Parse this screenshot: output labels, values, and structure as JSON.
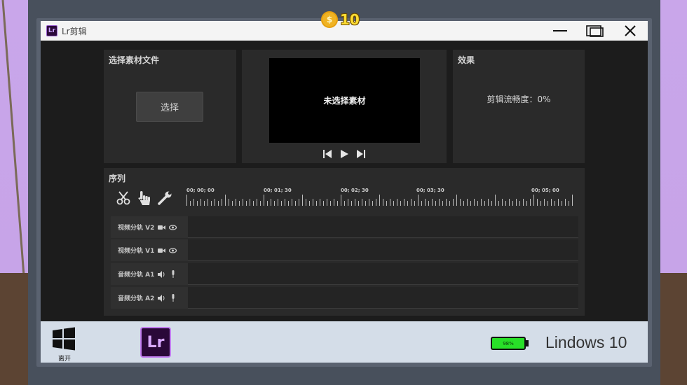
{
  "coins": {
    "icon": "dollar-coin-icon",
    "symbol": "$",
    "count": "10"
  },
  "window": {
    "app_icon_text": "Lr",
    "title": "Lr剪辑",
    "controls": [
      "minimize-icon",
      "restore-icon",
      "close-icon"
    ]
  },
  "select_panel": {
    "title": "选择素材文件",
    "button_label": "选择"
  },
  "preview_panel": {
    "placeholder": "未选择素材",
    "controls": [
      "skip-back-icon",
      "play-icon",
      "skip-forward-icon"
    ]
  },
  "effect_panel": {
    "title": "效果",
    "fluency_label": "剪辑流畅度：0%"
  },
  "sequence": {
    "title": "序列",
    "tools": [
      "scissors-icon",
      "hand-pointer-icon",
      "wrench-icon"
    ],
    "ruler_labels": [
      "00; 00; 00",
      "00; 01; 30",
      "00; 02; 30",
      "00; 03; 30",
      "00; 05; 00"
    ],
    "tracks": [
      {
        "label": "视频分轨 V2",
        "icons": [
          "camera-icon",
          "eye-icon"
        ]
      },
      {
        "label": "视频分轨 V1",
        "icons": [
          "camera-icon",
          "eye-icon"
        ]
      },
      {
        "label": "音频分轨 A1",
        "icons": [
          "speaker-icon",
          "mic-icon"
        ]
      },
      {
        "label": "音频分轨 A2",
        "icons": [
          "speaker-icon",
          "mic-icon"
        ]
      }
    ]
  },
  "taskbar": {
    "start_label": "离开",
    "app_label": "Lr",
    "battery_text": "98%",
    "battery_level": 0.98,
    "os_name": "Lindows 10"
  },
  "colors": {
    "battery": "#28e028",
    "coin": "#f0b323",
    "lr_accent": "#c27ef0"
  }
}
